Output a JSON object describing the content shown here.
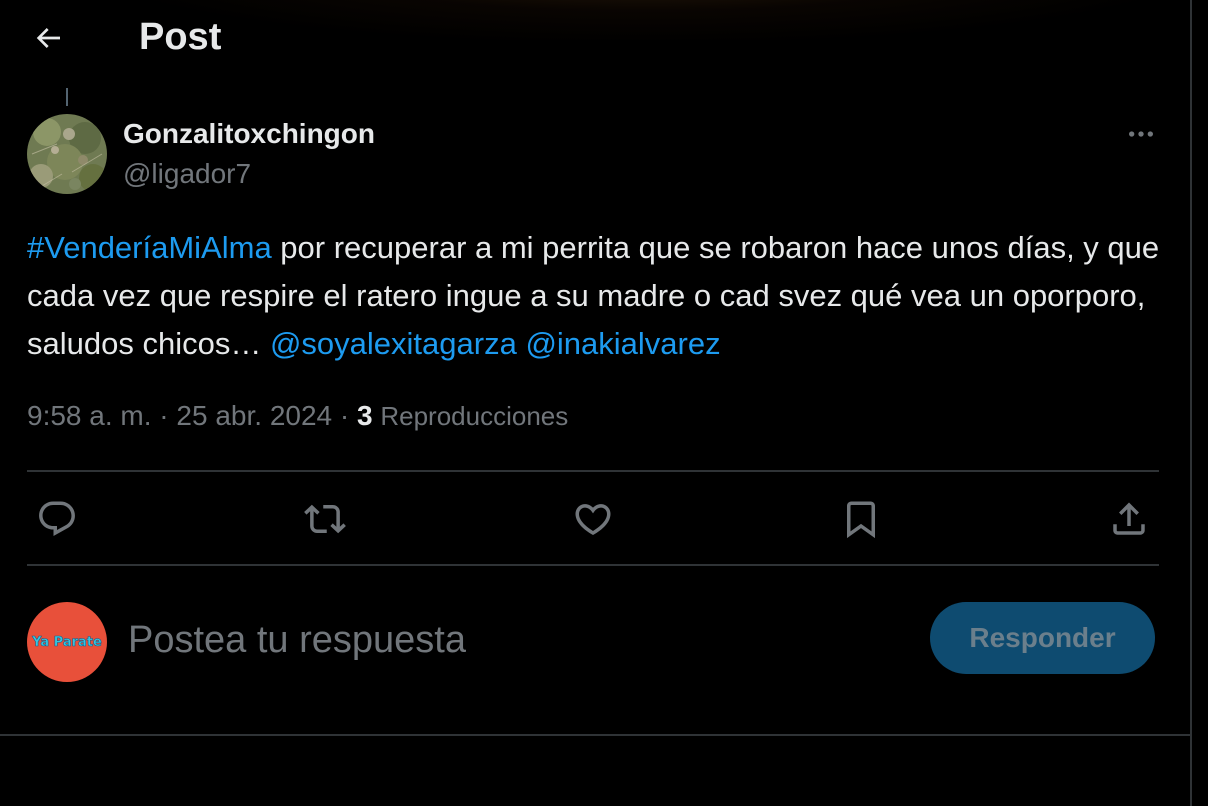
{
  "header": {
    "title": "Post",
    "back_icon": "arrow-left-icon"
  },
  "post": {
    "author": {
      "display_name": "Gonzalitoxchingon",
      "handle": "@ligador7"
    },
    "text": {
      "hashtag": "#VenderíaMiAlma",
      "body": " por recuperar a mi perrita que se robaron hace unos días, y que cada vez que respire el ratero ingue a su madre o cad svez qué vea un oporporo, saludos chicos… ",
      "mention_1": "@soyalexitagarza",
      "mention_2": "@inakialvarez"
    },
    "meta": {
      "time": "9:58 a. m.",
      "separator": " · ",
      "date": "25 abr. 2024",
      "views_count": "3",
      "views_label": "Reproducciones"
    },
    "actions": [
      "reply-icon",
      "repost-icon",
      "like-icon",
      "bookmark-icon",
      "share-icon"
    ]
  },
  "reply": {
    "avatar_text": "Ya Parate",
    "placeholder": "Postea tu respuesta",
    "button_label": "Responder"
  },
  "colors": {
    "background": "#000000",
    "text": "#e7e9ea",
    "muted": "#71767b",
    "link": "#1d9bf0",
    "divider": "#2f3336",
    "button_disabled": "#0e4b70"
  }
}
